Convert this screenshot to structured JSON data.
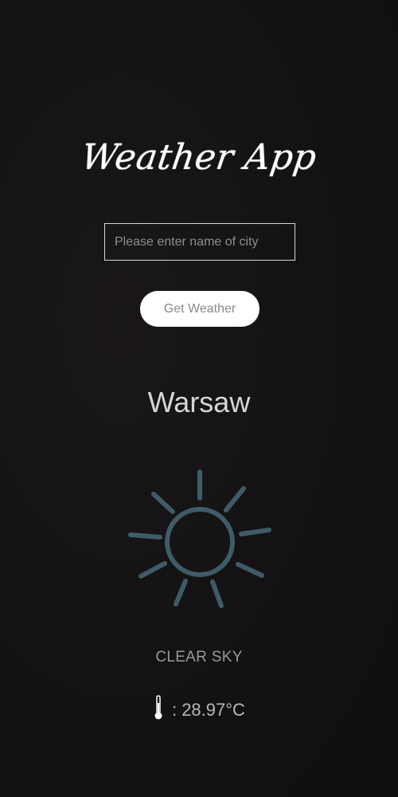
{
  "app": {
    "title": "Weather App"
  },
  "search": {
    "placeholder": "Please enter name of city",
    "value": "",
    "button_label": "Get Weather"
  },
  "weather": {
    "city": "Warsaw",
    "icon": "sun-icon",
    "condition": "CLEAR SKY",
    "temperature_prefix": ":",
    "temperature": "28.97°C"
  },
  "colors": {
    "background": "#141214",
    "sun_icon": "#3f5b67",
    "button_bg": "#ffffff",
    "text": "#d6d6d6"
  }
}
